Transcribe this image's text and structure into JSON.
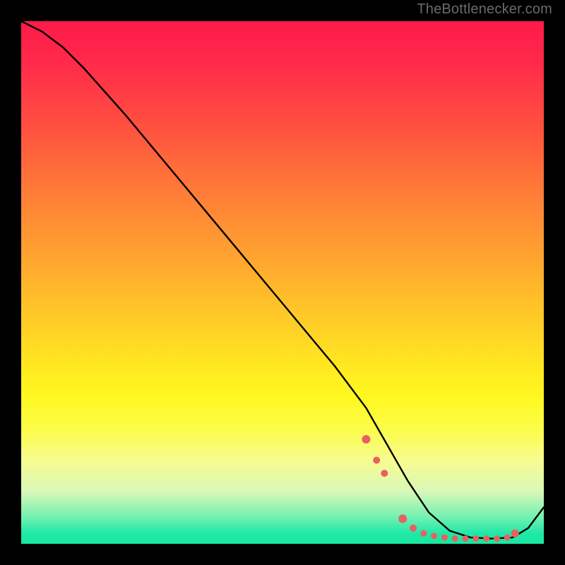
{
  "attribution": "TheBottlenecker.com",
  "chart_data": {
    "type": "line",
    "title": "",
    "xlabel": "",
    "ylabel": "",
    "xlim": [
      0,
      100
    ],
    "ylim": [
      0,
      100
    ],
    "curve": {
      "x": [
        0,
        4,
        8,
        12,
        20,
        30,
        40,
        50,
        60,
        66,
        70,
        74,
        78,
        82,
        86,
        90,
        94,
        97,
        100
      ],
      "y": [
        100,
        98,
        95,
        91,
        82,
        70,
        58,
        46,
        34,
        26,
        19,
        12,
        6,
        2.5,
        1.2,
        1.0,
        1.2,
        3.0,
        7.0
      ]
    },
    "markers": {
      "x": [
        66,
        68,
        69.5,
        73,
        75,
        77,
        79,
        81,
        83,
        85,
        87,
        89,
        91,
        93,
        94.5
      ],
      "y": [
        20,
        16,
        13.5,
        4.8,
        3.0,
        2.0,
        1.5,
        1.2,
        1.0,
        1.0,
        1.0,
        1.0,
        1.0,
        1.2,
        2.0
      ],
      "r": [
        6,
        5,
        5,
        6,
        5,
        4.5,
        4.5,
        4.5,
        4.5,
        4.5,
        4.5,
        4.5,
        4.5,
        4.5,
        5.5
      ]
    },
    "colors": {
      "curve": "#000000",
      "marker": "#e86060",
      "gradient_top": "#ff1a4a",
      "gradient_bottom": "#18e8a0"
    }
  }
}
